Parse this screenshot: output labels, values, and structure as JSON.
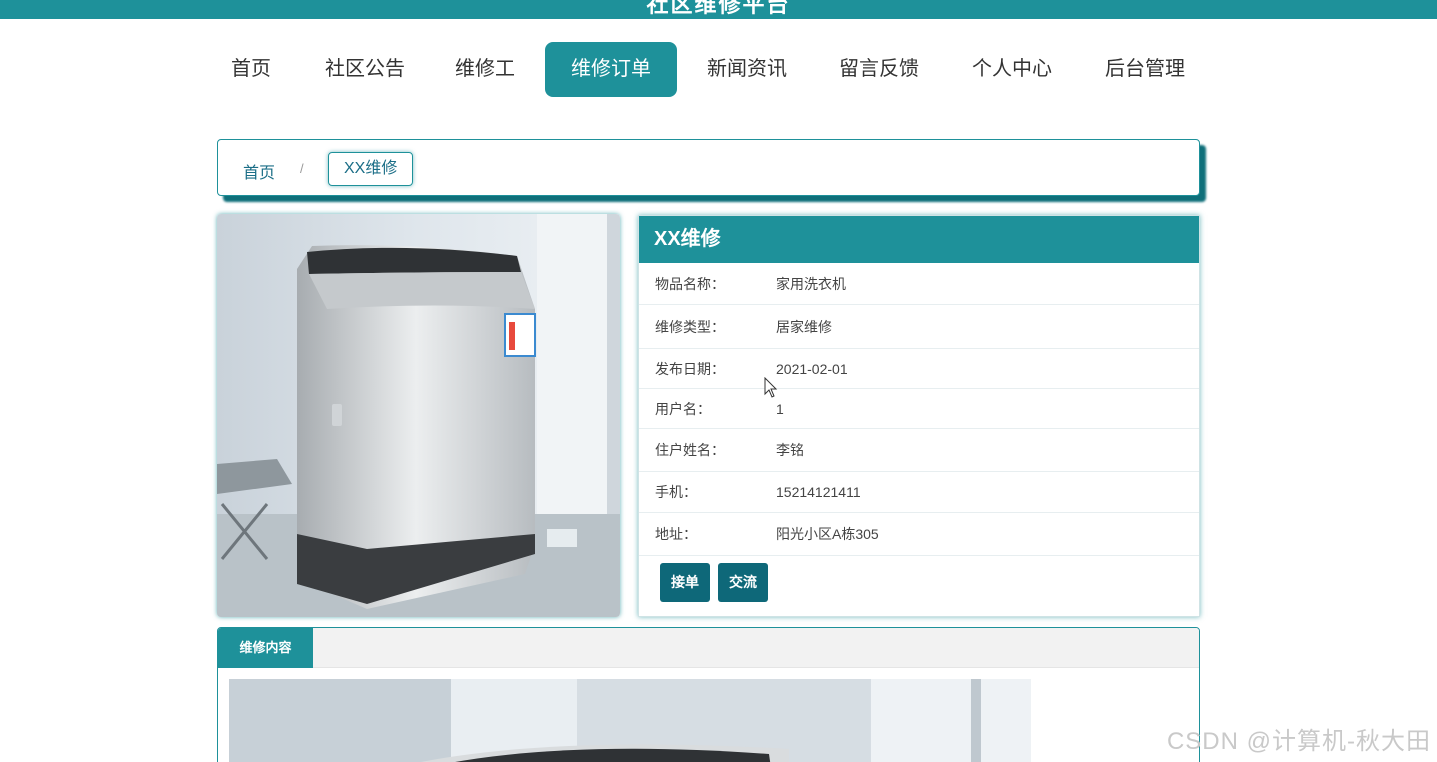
{
  "site": {
    "title": "社区维修平台"
  },
  "nav": {
    "items": [
      {
        "label": "首页"
      },
      {
        "label": "社区公告"
      },
      {
        "label": "维修工"
      },
      {
        "label": "维修订单"
      },
      {
        "label": "新闻资讯"
      },
      {
        "label": "留言反馈"
      },
      {
        "label": "个人中心"
      },
      {
        "label": "后台管理"
      }
    ],
    "active": "维修订单"
  },
  "breadcrumb": {
    "home": "首页",
    "separator": "/",
    "current": "XX维修"
  },
  "detail": {
    "title": "XX维修",
    "fields": [
      {
        "label": "物品名称：",
        "value": "家用洗衣机"
      },
      {
        "label": "维修类型：",
        "value": "居家维修"
      },
      {
        "label": "发布日期：",
        "value": "2021-02-01"
      },
      {
        "label": "用户名：",
        "value": "1"
      },
      {
        "label": "住户姓名：",
        "value": "李铭"
      },
      {
        "label": "手机：",
        "value": "15214121411"
      },
      {
        "label": "地址：",
        "value": "阳光小区A栋305"
      }
    ],
    "buttons": {
      "accept": "接单",
      "chat": "交流"
    }
  },
  "content": {
    "tab_label": "维修内容"
  },
  "watermark": "CSDN @计算机-秋大田",
  "colors": {
    "primary": "#1e919a",
    "button": "#0e6879",
    "link": "#1b6e87"
  }
}
